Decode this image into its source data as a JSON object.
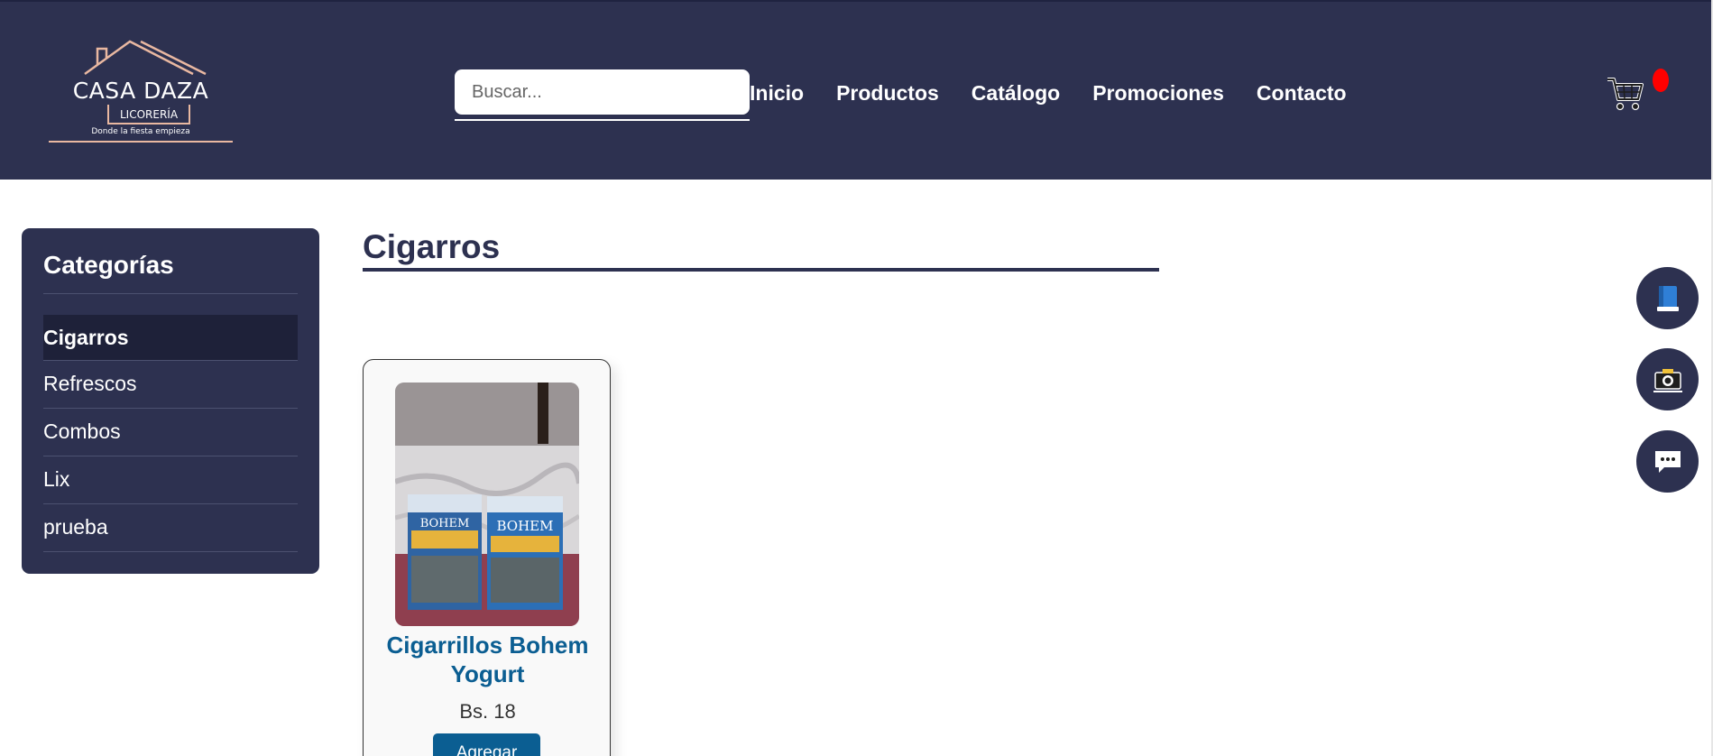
{
  "header": {
    "logo": {
      "name": "CASA DAZA",
      "subtitle": "LICORERÍA",
      "tagline": "Donde la fiesta empieza"
    },
    "search": {
      "placeholder": "Buscar...",
      "value": ""
    },
    "nav": [
      {
        "label": "Inicio"
      },
      {
        "label": "Productos"
      },
      {
        "label": "Catálogo"
      },
      {
        "label": "Promociones"
      },
      {
        "label": "Contacto"
      }
    ],
    "cart_icon": "cart-icon",
    "cart_badge_color": "#ff0000"
  },
  "sidebar": {
    "title": "Categorías",
    "items": [
      {
        "label": "Cigarros",
        "active": true
      },
      {
        "label": "Refrescos",
        "active": false
      },
      {
        "label": "Combos",
        "active": false
      },
      {
        "label": "Lix",
        "active": false
      },
      {
        "label": "prueba",
        "active": false
      }
    ]
  },
  "main": {
    "title": "Cigarros",
    "products": [
      {
        "name": "Cigarrillos Bohem Yogurt",
        "price": "Bs. 18",
        "button_label": "Agregar"
      }
    ]
  },
  "floating_buttons": [
    {
      "icon": "book-icon"
    },
    {
      "icon": "camera-icon"
    },
    {
      "icon": "chat-icon"
    }
  ],
  "colors": {
    "primary": "#2d3150",
    "accent": "#0b5e92",
    "logo_accent": "#e9b8a1"
  }
}
